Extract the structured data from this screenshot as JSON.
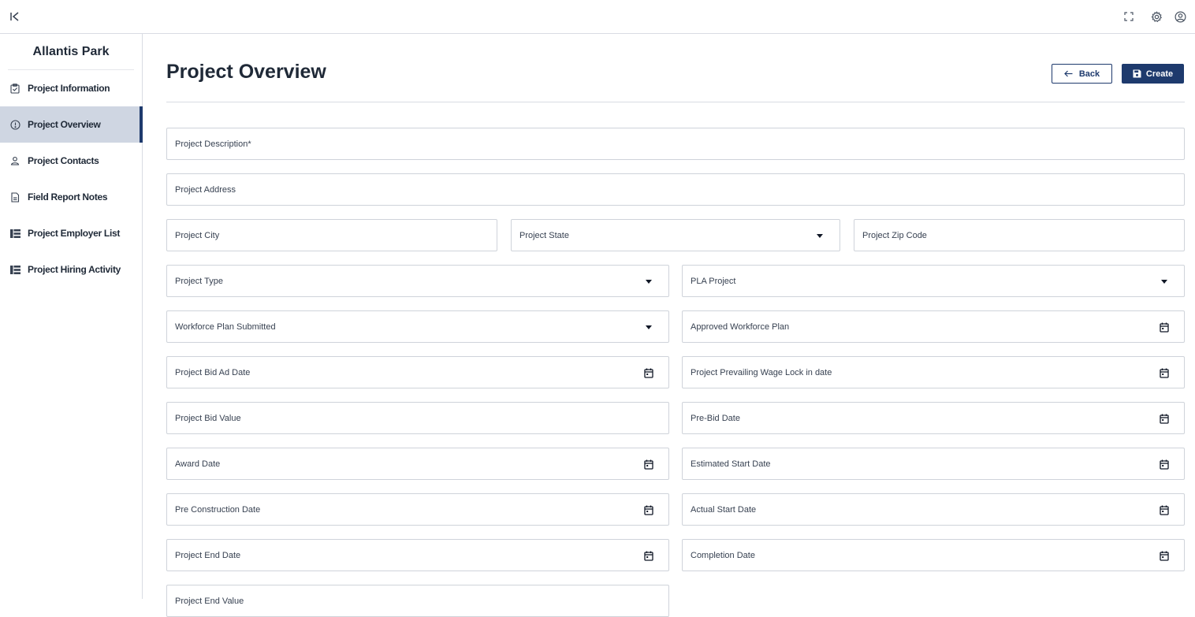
{
  "topbar": {
    "collapse_glyph": "K",
    "icons": [
      "fullscreen-icon",
      "gear-icon",
      "user-icon"
    ]
  },
  "sidebar": {
    "title": "Allantis Park",
    "items": [
      {
        "label": "Project Information",
        "icon": "clipboard-icon",
        "active": false
      },
      {
        "label": "Project Overview",
        "icon": "info-circle-icon",
        "active": true
      },
      {
        "label": "Project Contacts",
        "icon": "person-icon",
        "active": false
      },
      {
        "label": "Field Report Notes",
        "icon": "document-icon",
        "active": false
      },
      {
        "label": "Project Employer List",
        "icon": "table-icon",
        "active": false
      },
      {
        "label": "Project Hiring Activity",
        "icon": "table-icon",
        "active": false
      }
    ],
    "active_color": "#1e3a6d",
    "active_bg": "#cfd6e2"
  },
  "main": {
    "title": "Project Overview",
    "back_label": "Back",
    "create_label": "Create",
    "fields": {
      "description": "Project Description*",
      "address": "Project Address",
      "city": "Project City",
      "state": "Project State",
      "zip": "Project Zip Code",
      "type": "Project Type",
      "pla": "PLA Project",
      "workforce_submitted": "Workforce Plan Submitted",
      "approved_workforce": "Approved Workforce Plan",
      "bid_ad_date": "Project Bid Ad Date",
      "prevailing_wage": "Project Prevailing Wage Lock in date",
      "bid_value": "Project Bid Value",
      "pre_bid_date": "Pre-Bid Date",
      "award_date": "Award Date",
      "estimated_start": "Estimated Start Date",
      "pre_construction": "Pre Construction Date",
      "actual_start": "Actual Start Date",
      "end_date": "Project End Date",
      "completion_date": "Completion Date",
      "partial_field": "Project End Value"
    }
  },
  "colors": {
    "primary": "#1e3a6d",
    "border": "#cfd3da"
  }
}
